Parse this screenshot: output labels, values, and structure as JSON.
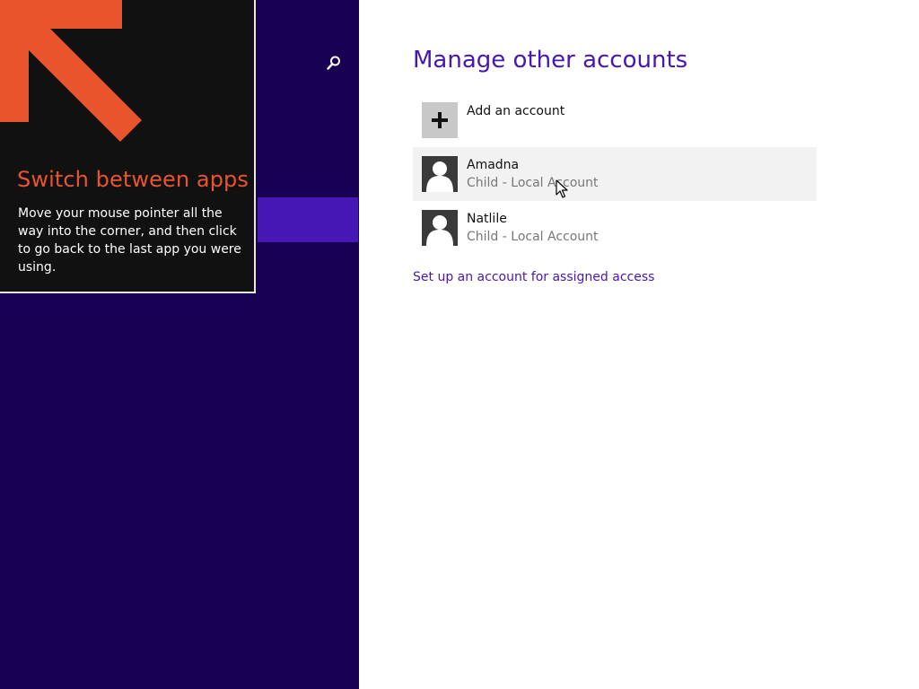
{
  "tip": {
    "title": "Switch between apps",
    "body": "Move your mouse pointer all the way into the corner, and then click to go back to the last app you were using.",
    "arrow_icon": "arrow-up-left-icon",
    "accent_color": "#e8542c"
  },
  "left_pane": {
    "search_icon": "search-icon",
    "background_color": "#180053",
    "selected_color": "#4617b4"
  },
  "main": {
    "title": "Manage other accounts",
    "add_account": {
      "label": "Add an account",
      "icon": "plus-icon"
    },
    "accounts": [
      {
        "name": "Amadna",
        "type": "Child - Local Account",
        "icon": "user-avatar-icon",
        "hovered": true
      },
      {
        "name": "Natlile",
        "type": "Child - Local Account",
        "icon": "user-avatar-icon",
        "hovered": false
      }
    ],
    "assigned_access_link": "Set up an account for assigned access"
  }
}
